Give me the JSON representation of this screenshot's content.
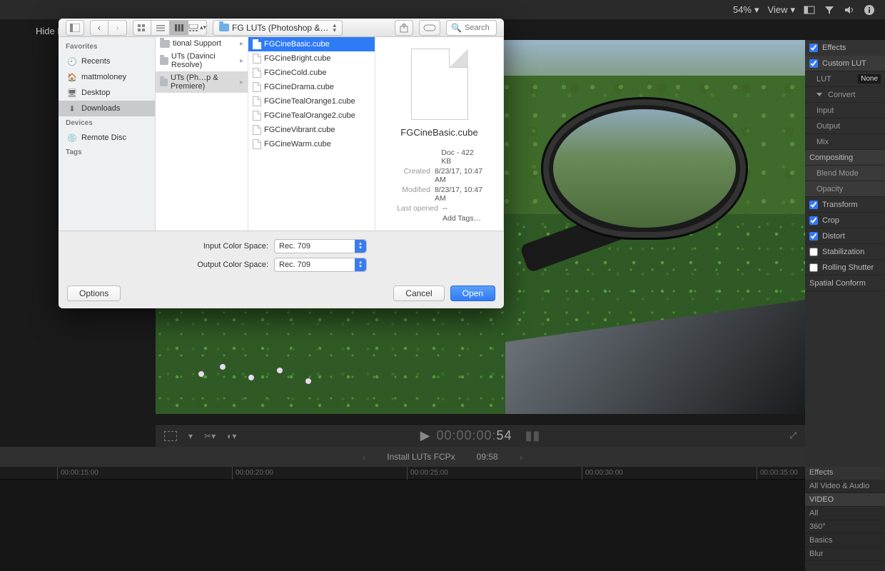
{
  "topbar": {
    "hide_label": "Hide R",
    "zoom": "54%",
    "view": "View"
  },
  "dialog": {
    "path_label": "FG LUTs (Photoshop &…",
    "search_placeholder": "Search",
    "sidebar": {
      "favorites_hdr": "Favorites",
      "items": [
        "Recents",
        "mattmoloney",
        "Desktop",
        "Downloads"
      ],
      "devices_hdr": "Devices",
      "devices": [
        "Remote Disc"
      ],
      "tags_hdr": "Tags"
    },
    "col1": {
      "items": [
        {
          "label": "tional Support"
        },
        {
          "label": "UTs (Davinci Resolve)"
        },
        {
          "label": "UTs (Ph…p & Premiere)",
          "selected": true
        }
      ]
    },
    "col2": {
      "items": [
        "FGCineBasic.cube",
        "FGCineBright.cube",
        "FGCineCold.cube",
        "FGCineDrama.cube",
        "FGCineTealOrange1.cube",
        "FGCineTealOrange2.cube",
        "FGCineVibrant.cube",
        "FGCineWarm.cube"
      ],
      "selected_index": 0
    },
    "preview": {
      "name": "FGCineBasic.cube",
      "kind": "Doc - 422 KB",
      "created_k": "Created",
      "created_v": "8/23/17, 10:47 AM",
      "modified_k": "Modified",
      "modified_v": "8/23/17, 10:47 AM",
      "opened_k": "Last opened",
      "opened_v": "--",
      "addtags": "Add Tags…"
    },
    "opts": {
      "input_label": "Input Color Space:",
      "output_label": "Output Color Space:",
      "input_value": "Rec. 709",
      "output_value": "Rec. 709"
    },
    "footer": {
      "options": "Options",
      "cancel": "Cancel",
      "open": "Open"
    }
  },
  "playbar": {
    "timecode": "00:00:00:",
    "frames": "54"
  },
  "clipbar": {
    "title": "Install LUTs FCPx",
    "duration": "09:58"
  },
  "ruler": {
    "ticks": [
      "00:00:15:00",
      "00:00:20:00",
      "00:00:25:00",
      "00:00:30:00",
      "00:00:35:00"
    ]
  },
  "inspector": {
    "effects_hdr": "Effects",
    "rows": [
      {
        "label": "Custom LUT",
        "cb": true,
        "hl": true
      },
      {
        "label": "LUT",
        "sub": true,
        "val": "None"
      },
      {
        "label": "Convert",
        "sub": true,
        "tri": true
      },
      {
        "label": "Input",
        "sub": true
      },
      {
        "label": "Output",
        "sub": true
      },
      {
        "label": "Mix",
        "sub": true
      },
      {
        "label": "Compositing",
        "hl": true
      },
      {
        "label": "Blend Mode",
        "sub": true,
        "hl": true
      },
      {
        "label": "Opacity",
        "sub": true,
        "hl": true
      },
      {
        "label": "Transform",
        "cb": true
      },
      {
        "label": "Crop",
        "cb": true
      },
      {
        "label": "Distort",
        "cb": true
      },
      {
        "label": "Stabilization",
        "cb": false
      },
      {
        "label": "Rolling Shutter",
        "cb": false
      },
      {
        "label": "Spatial Conform"
      }
    ]
  },
  "fxbrowser": {
    "hdr": "Effects",
    "rows": [
      {
        "label": "All Video & Audio"
      },
      {
        "label": "VIDEO",
        "cat": true
      },
      {
        "label": "All"
      },
      {
        "label": "360°"
      },
      {
        "label": "Basics"
      },
      {
        "label": "Blur"
      }
    ]
  }
}
